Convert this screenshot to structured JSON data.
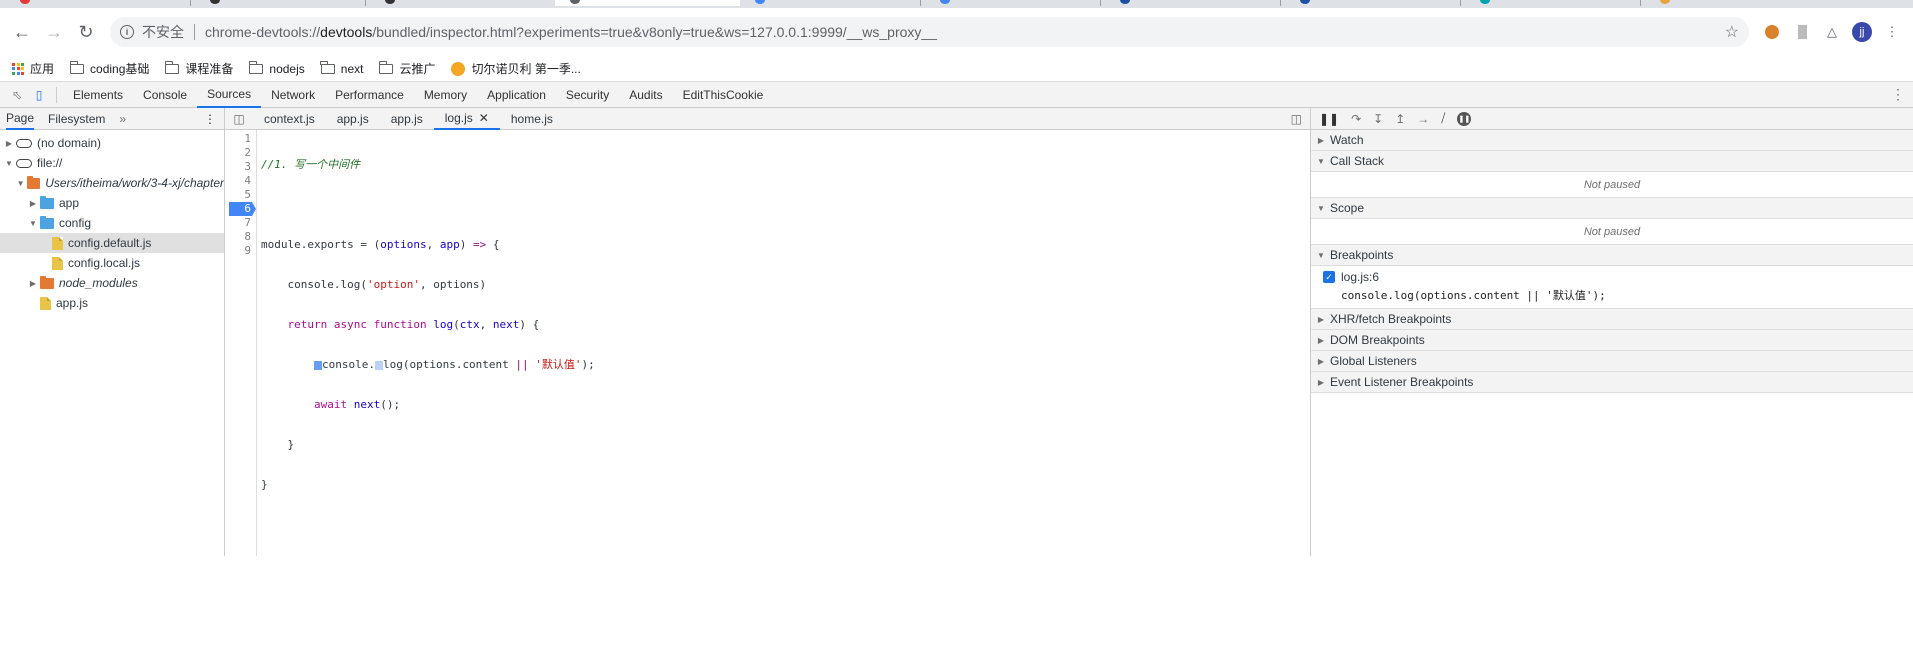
{
  "browser": {
    "url_scheme": "chrome-devtools://",
    "url_host": "devtools",
    "url_rest": "/bundled/inspector.html?experiments=true&v8only=true&ws=127.0.0.1:9999/__ws_proxy__",
    "security_label": "不安全",
    "avatar_letter": "jj"
  },
  "bookmarks": [
    {
      "label": "应用"
    },
    {
      "label": "coding基础"
    },
    {
      "label": "课程准备"
    },
    {
      "label": "nodejs"
    },
    {
      "label": "next"
    },
    {
      "label": "云推广"
    },
    {
      "label": "切尔诺贝利 第一季..."
    }
  ],
  "devtools": {
    "tabs": [
      "Elements",
      "Console",
      "Sources",
      "Network",
      "Performance",
      "Memory",
      "Application",
      "Security",
      "Audits",
      "EditThisCookie"
    ],
    "active_tab": "Sources"
  },
  "navigator": {
    "tabs": [
      "Page",
      "Filesystem"
    ],
    "tree": [
      {
        "label": "(no domain)"
      },
      {
        "label": "file://"
      },
      {
        "label": "Users/itheima/work/3-4-xj/chapter"
      },
      {
        "label": "app"
      },
      {
        "label": "config"
      },
      {
        "label": "config.default.js"
      },
      {
        "label": "config.local.js"
      },
      {
        "label": "node_modules"
      },
      {
        "label": "app.js"
      }
    ]
  },
  "editor": {
    "file_tabs": [
      "context.js",
      "app.js",
      "app.js",
      "log.js",
      "home.js"
    ],
    "active_file": "log.js",
    "line_numbers": [
      "1",
      "2",
      "3",
      "4",
      "5",
      "6",
      "7",
      "8",
      "9"
    ],
    "breakpoint_line": "6"
  },
  "debugger": {
    "watch": "Watch",
    "call_stack": "Call Stack",
    "scope": "Scope",
    "breakpoints": "Breakpoints",
    "not_paused": "Not paused",
    "breakpoint_location": "log.js:6",
    "breakpoint_code": "console.log(options.content || '默认值');",
    "collapsed_sections": [
      "XHR/fetch Breakpoints",
      "DOM Breakpoints",
      "Global Listeners",
      "Event Listener Breakpoints"
    ]
  },
  "colors": {
    "accent": "#1a73e8",
    "breakpoint": "#4285f4"
  }
}
